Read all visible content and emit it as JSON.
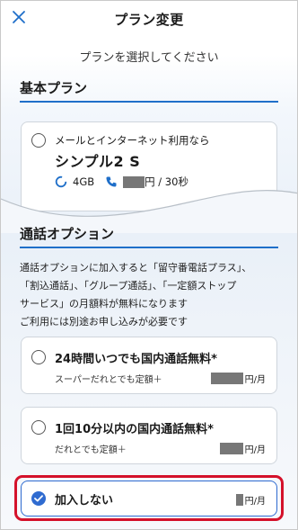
{
  "header": {
    "title": "プラン変更",
    "close_icon": "close-icon"
  },
  "subtitle": "プランを選択してください",
  "basic_plan": {
    "heading": "基本プラン",
    "card": {
      "description": "メールとインターネット利用なら",
      "name": "シンプル2 S",
      "data_amount": "4GB",
      "price_suffix": "円 / 30秒"
    }
  },
  "call_option": {
    "heading": "通話オプション",
    "paragraph": [
      "通話オプションに加入すると「留守番電話プラス」、",
      "「割込通話」、「グループ通話」、「一定額ストップ",
      "サービス」の月額料が無料になります",
      "ご利用には別途お申し込みが必要です"
    ],
    "options": [
      {
        "label": "24時間いつでも国内通話無料*",
        "sub": "スーパーだれとでも定額＋",
        "price_suffix": "円/月",
        "selected": false
      },
      {
        "label": "1回10分以内の国内通話無料*",
        "sub": "だれとでも定額＋",
        "price_suffix": "円/月",
        "selected": false
      },
      {
        "label": "加入しない",
        "sub": "",
        "price_suffix": "円/月",
        "selected": true
      }
    ]
  },
  "colors": {
    "accent": "#1f6fc9",
    "selected": "#2f6bd0",
    "highlight": "#d4112a"
  }
}
